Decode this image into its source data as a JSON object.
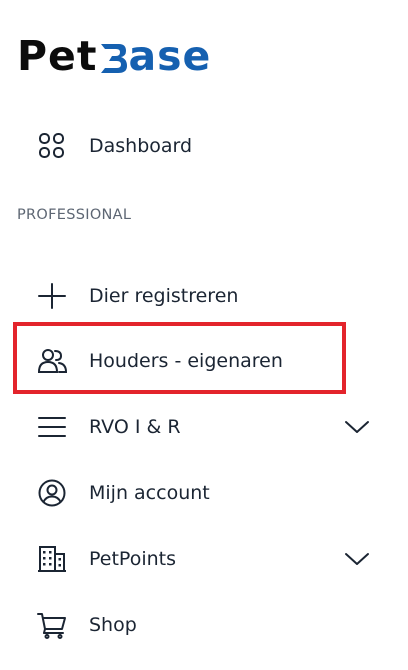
{
  "logo": {
    "part1": "Pet",
    "part2": "ase"
  },
  "nav": {
    "dashboard": {
      "label": "Dashboard",
      "icon": "grid-icon"
    },
    "section_title": "PROFESSIONAL",
    "register": {
      "label": "Dier registreren",
      "icon": "plus-icon"
    },
    "owners": {
      "label": "Houders - eigenaren",
      "icon": "users-icon"
    },
    "rvo": {
      "label": "RVO I & R",
      "icon": "menu-icon"
    },
    "account": {
      "label": "Mijn account",
      "icon": "user-circle-icon"
    },
    "petpoints": {
      "label": "PetPoints",
      "icon": "building-icon"
    },
    "shop": {
      "label": "Shop",
      "icon": "cart-icon"
    }
  },
  "colors": {
    "brand_blue": "#1560b0",
    "text": "#1b2533",
    "highlight": "#e3242b",
    "muted": "#5d6673"
  }
}
